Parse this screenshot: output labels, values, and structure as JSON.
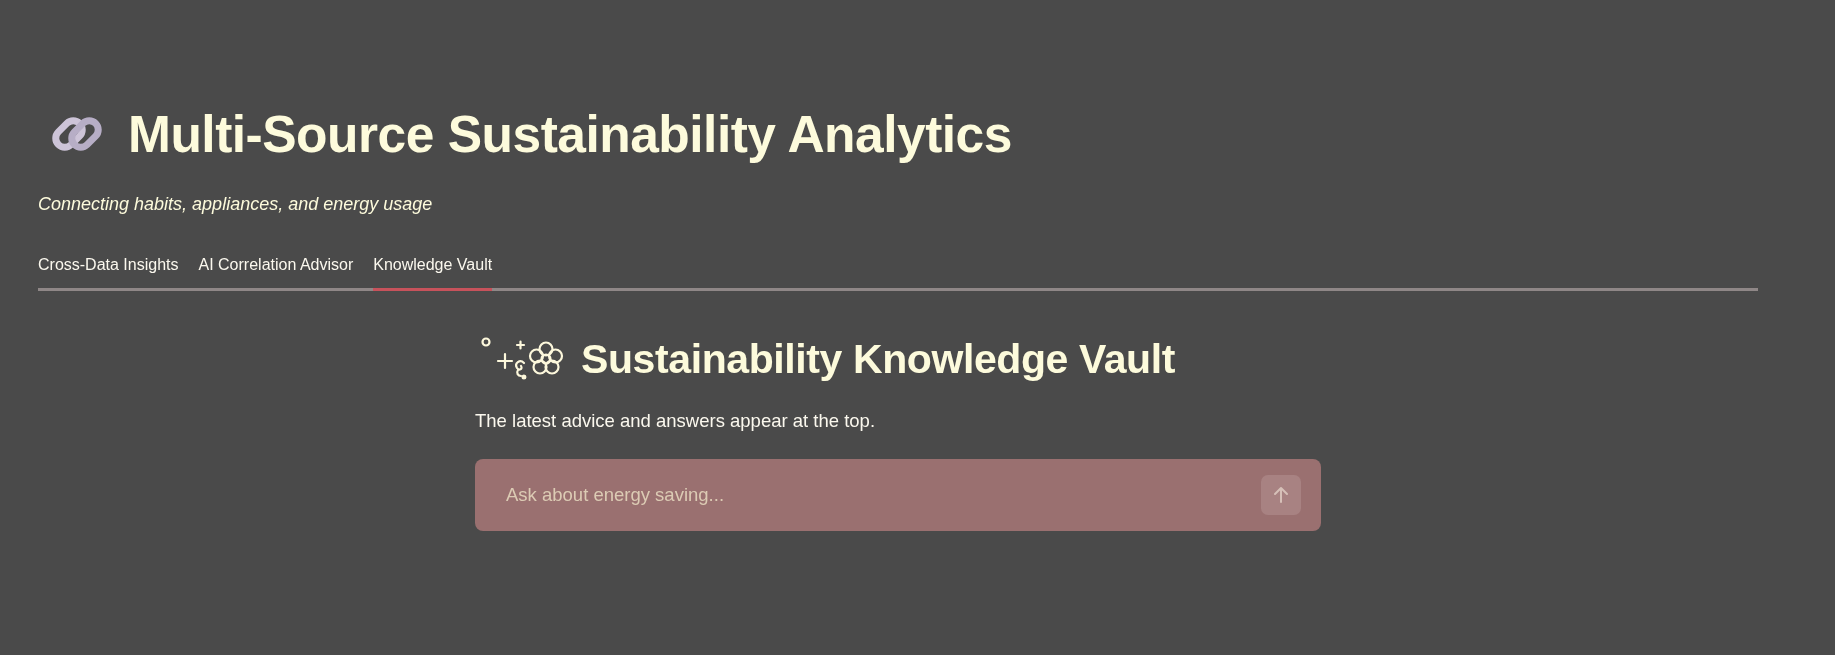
{
  "header": {
    "title": "Multi-Source Sustainability Analytics",
    "subtitle": "Connecting habits, appliances, and energy usage"
  },
  "tabs": [
    {
      "label": "Cross-Data Insights",
      "selected": false
    },
    {
      "label": "AI Correlation Advisor",
      "selected": false
    },
    {
      "label": "Knowledge Vault",
      "selected": true
    }
  ],
  "vault": {
    "heading": "Sustainability Knowledge Vault",
    "note": "The latest advice and answers appear at the top.",
    "chat_input": {
      "placeholder": "Ask about energy saving...",
      "send_button": {
        "disabled": true
      }
    }
  }
}
